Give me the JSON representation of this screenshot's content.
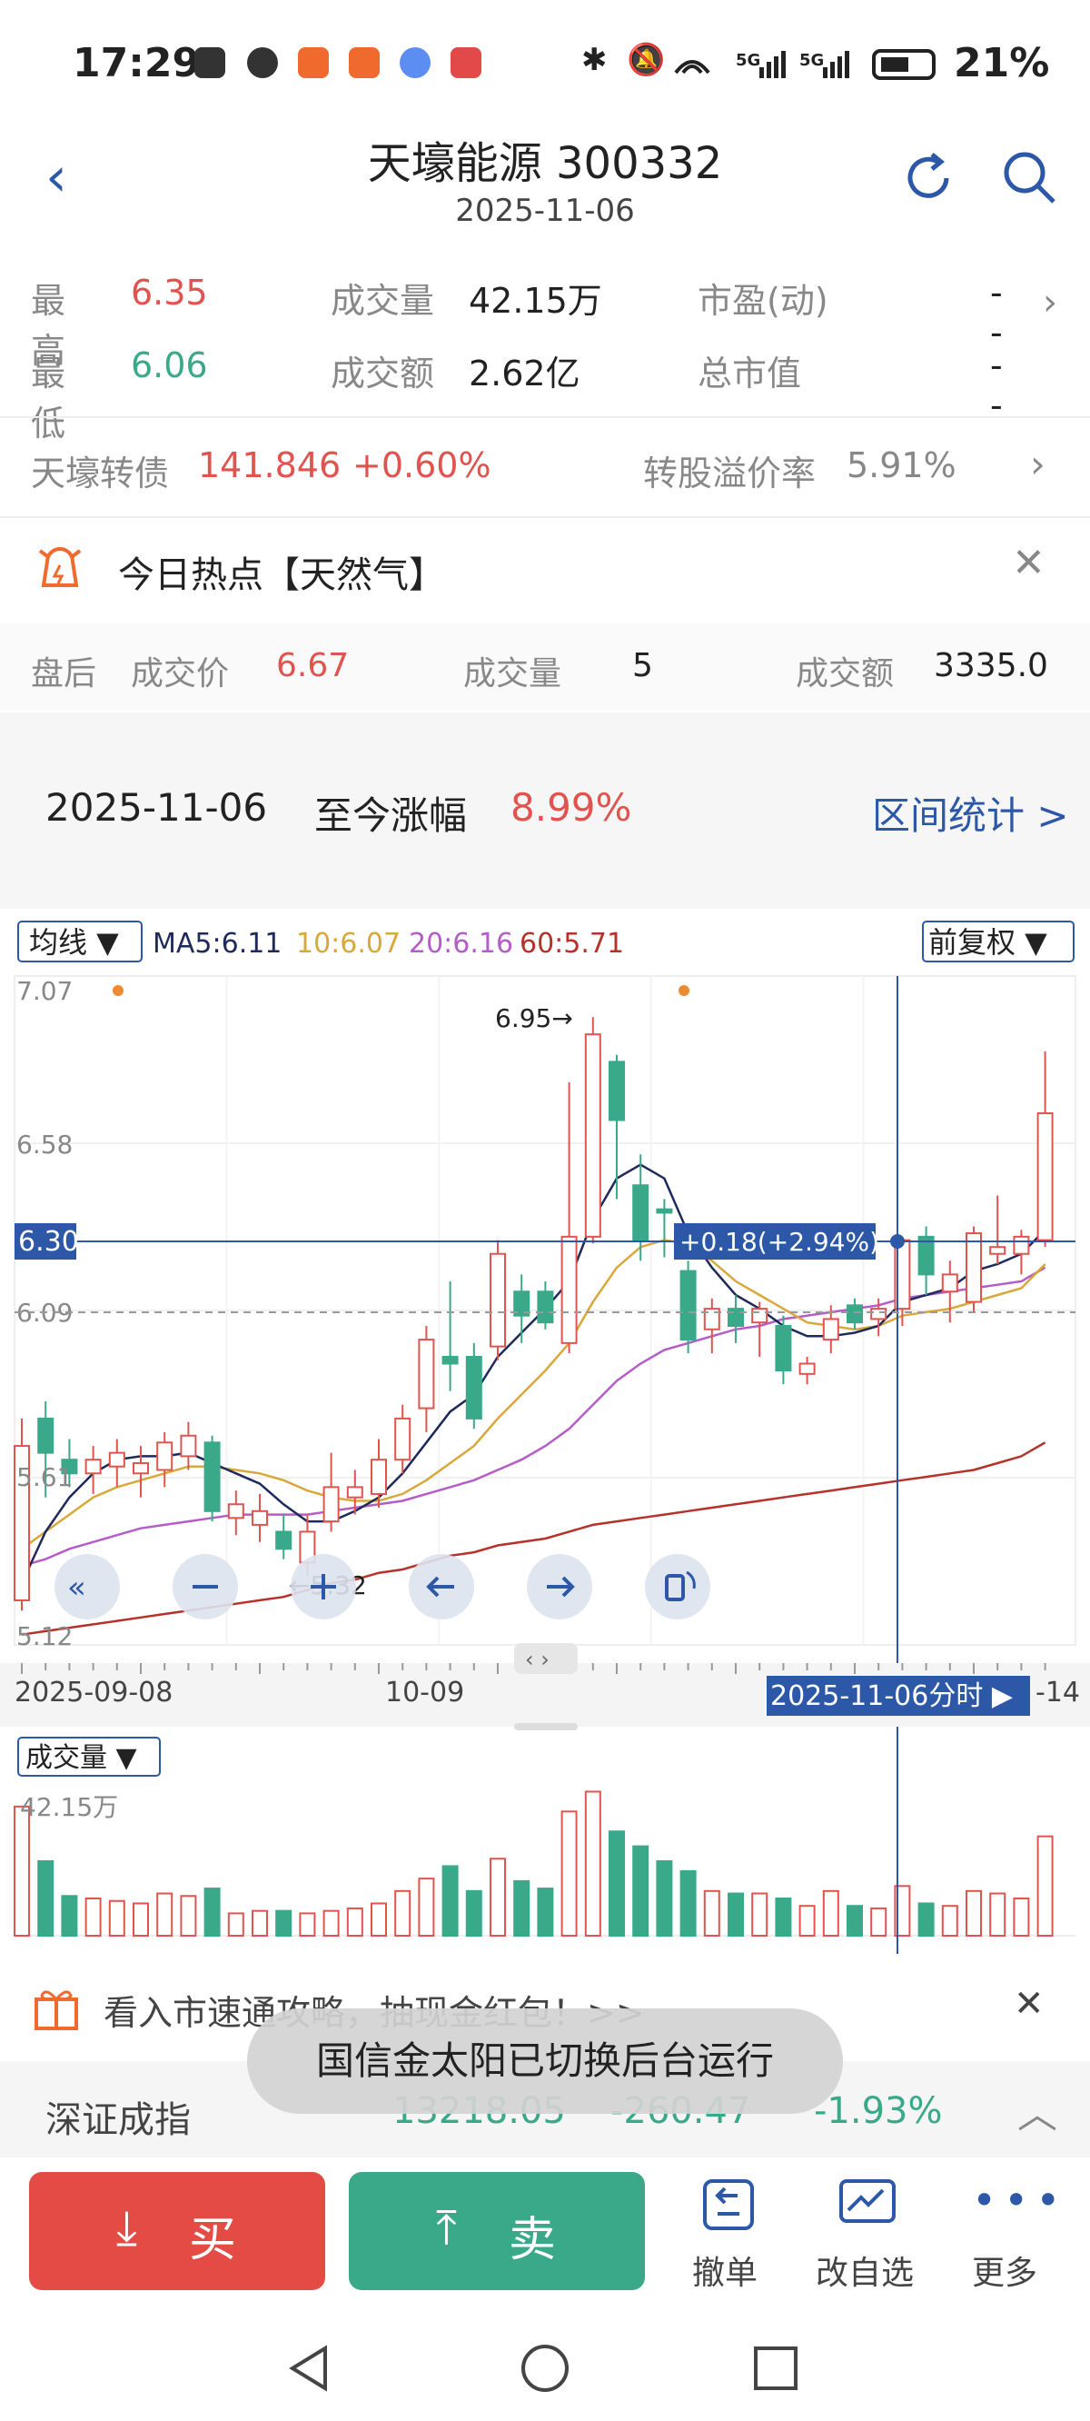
{
  "status_bar": {
    "time": "17:29",
    "battery": "21%"
  },
  "header": {
    "title": "天壕能源 300332",
    "date": "2025-11-06"
  },
  "quote": {
    "high_label": "最高",
    "high_value": "6.35",
    "low_label": "最低",
    "low_value": "6.06",
    "volume_label": "成交量",
    "volume_value": "42.15万",
    "amount_label": "成交额",
    "amount_value": "2.62亿",
    "pe_label": "市盈(动)",
    "pe_value": "--",
    "mcap_label": "总市值",
    "mcap_value": "--"
  },
  "bond": {
    "name": "天壕转债",
    "price": "141.846",
    "change": "+0.60%",
    "premium_label": "转股溢价率",
    "premium_value": "5.91%"
  },
  "hot": {
    "text": "今日热点【天然气】"
  },
  "after_hours": {
    "label": "盘后",
    "price_label": "成交价",
    "price": "6.67",
    "vol_label": "成交量",
    "vol": "5",
    "amt_label": "成交额",
    "amt": "3335.0"
  },
  "range": {
    "date": "2025-11-06",
    "label": "至今涨幅",
    "value": "8.99%",
    "stats_link": "区间统计 >"
  },
  "indicator": {
    "selector": "均线 ▼",
    "ma5": "MA5:6.11",
    "ma10": "10:6.07",
    "ma20": "20:6.16",
    "ma60": "60:5.71",
    "adjust": "前复权 ▼"
  },
  "chart_labels": {
    "high_marker": "6.95→",
    "low_marker": "←5.32",
    "crosshair_price": "6.30",
    "crosshair_change": "+0.18(+2.94%)",
    "crosshair_date": "2025-11-06分时 ▶",
    "date_left": "2025-09-08",
    "date_mid": "10-09",
    "date_right": "-14"
  },
  "volume_panel": {
    "selector": "成交量 ▼",
    "max_label": "42.15万"
  },
  "promo": {
    "text": "看入市速通攻略，抽现金红包！>>"
  },
  "index_bar": {
    "name": "深证成指",
    "value": "13218.05",
    "change": "-260.47",
    "pct": "-1.93%"
  },
  "toast": {
    "text": "国信金太阳已切换后台运行"
  },
  "bottom": {
    "buy": "买",
    "sell": "卖",
    "cancel": "撤单",
    "edit_watch": "改自选",
    "more": "更多"
  },
  "colors": {
    "up": "#e0534f",
    "down": "#3aa98a",
    "ma5": "#1f2a5c",
    "ma10": "#d8a83a",
    "ma20": "#b45cc8",
    "ma60": "#b5322a"
  },
  "chart_data": {
    "type": "candlestick",
    "ylim": [
      5.12,
      7.07
    ],
    "yticks": [
      "7.07",
      "6.58",
      "6.09",
      "5.61",
      "5.12"
    ],
    "candles": [
      {
        "o": 5.25,
        "c": 5.7,
        "h": 5.78,
        "l": 5.22
      },
      {
        "o": 5.78,
        "c": 5.68,
        "h": 5.83,
        "l": 5.55
      },
      {
        "o": 5.66,
        "c": 5.62,
        "h": 5.72,
        "l": 5.58
      },
      {
        "o": 5.62,
        "c": 5.66,
        "h": 5.7,
        "l": 5.56
      },
      {
        "o": 5.64,
        "c": 5.68,
        "h": 5.72,
        "l": 5.58
      },
      {
        "o": 5.62,
        "c": 5.65,
        "h": 5.7,
        "l": 5.55
      },
      {
        "o": 5.63,
        "c": 5.71,
        "h": 5.74,
        "l": 5.58
      },
      {
        "o": 5.67,
        "c": 5.73,
        "h": 5.77,
        "l": 5.63
      },
      {
        "o": 5.71,
        "c": 5.51,
        "h": 5.73,
        "l": 5.48
      },
      {
        "o": 5.49,
        "c": 5.53,
        "h": 5.57,
        "l": 5.44
      },
      {
        "o": 5.47,
        "c": 5.51,
        "h": 5.56,
        "l": 5.42
      },
      {
        "o": 5.45,
        "c": 5.4,
        "h": 5.5,
        "l": 5.37
      },
      {
        "o": 5.36,
        "c": 5.45,
        "h": 5.5,
        "l": 5.32
      },
      {
        "o": 5.48,
        "c": 5.58,
        "h": 5.68,
        "l": 5.45
      },
      {
        "o": 5.55,
        "c": 5.58,
        "h": 5.63,
        "l": 5.5
      },
      {
        "o": 5.56,
        "c": 5.66,
        "h": 5.72,
        "l": 5.52
      },
      {
        "o": 5.66,
        "c": 5.78,
        "h": 5.82,
        "l": 5.62
      },
      {
        "o": 5.81,
        "c": 6.01,
        "h": 6.05,
        "l": 5.74
      },
      {
        "o": 5.96,
        "c": 5.94,
        "h": 6.18,
        "l": 5.86
      },
      {
        "o": 5.96,
        "c": 5.78,
        "h": 6.0,
        "l": 5.75
      },
      {
        "o": 5.99,
        "c": 6.26,
        "h": 6.3,
        "l": 5.95
      },
      {
        "o": 6.15,
        "c": 6.08,
        "h": 6.2,
        "l": 6.0
      },
      {
        "o": 6.15,
        "c": 6.06,
        "h": 6.18,
        "l": 6.04
      },
      {
        "o": 6.0,
        "c": 6.31,
        "h": 6.76,
        "l": 5.97
      },
      {
        "o": 6.31,
        "c": 6.9,
        "h": 6.95,
        "l": 6.29
      },
      {
        "o": 6.82,
        "c": 6.65,
        "h": 6.84,
        "l": 6.42
      },
      {
        "o": 6.46,
        "c": 6.3,
        "h": 6.55,
        "l": 6.24
      },
      {
        "o": 6.39,
        "c": 6.38,
        "h": 6.42,
        "l": 6.25
      },
      {
        "o": 6.21,
        "c": 6.01,
        "h": 6.24,
        "l": 5.97
      },
      {
        "o": 6.04,
        "c": 6.1,
        "h": 6.13,
        "l": 5.97
      },
      {
        "o": 6.1,
        "c": 6.05,
        "h": 6.14,
        "l": 6.0
      },
      {
        "o": 6.06,
        "c": 6.1,
        "h": 6.12,
        "l": 5.96
      },
      {
        "o": 6.05,
        "c": 5.92,
        "h": 6.08,
        "l": 5.88
      },
      {
        "o": 5.91,
        "c": 5.94,
        "h": 5.96,
        "l": 5.88
      },
      {
        "o": 6.01,
        "c": 6.07,
        "h": 6.11,
        "l": 5.97
      },
      {
        "o": 6.11,
        "c": 6.06,
        "h": 6.13,
        "l": 6.04
      },
      {
        "o": 6.07,
        "c": 6.1,
        "h": 6.13,
        "l": 6.02
      },
      {
        "o": 6.1,
        "c": 6.3,
        "h": 6.31,
        "l": 6.05
      },
      {
        "o": 6.31,
        "c": 6.2,
        "h": 6.34,
        "l": 6.14
      },
      {
        "o": 6.15,
        "c": 6.2,
        "h": 6.24,
        "l": 6.06
      },
      {
        "o": 6.12,
        "c": 6.32,
        "h": 6.34,
        "l": 6.09
      },
      {
        "o": 6.26,
        "c": 6.28,
        "h": 6.43,
        "l": 6.23
      },
      {
        "o": 6.26,
        "c": 6.31,
        "h": 6.33,
        "l": 6.2
      },
      {
        "o": 6.3,
        "c": 6.67,
        "h": 6.85,
        "l": 6.28
      }
    ],
    "ma5": [
      5.3,
      5.45,
      5.55,
      5.62,
      5.66,
      5.67,
      5.67,
      5.68,
      5.65,
      5.62,
      5.59,
      5.53,
      5.48,
      5.48,
      5.51,
      5.55,
      5.62,
      5.71,
      5.8,
      5.85,
      5.96,
      6.03,
      6.1,
      6.18,
      6.36,
      6.48,
      6.52,
      6.48,
      6.32,
      6.22,
      6.14,
      6.1,
      6.05,
      6.02,
      6.02,
      6.03,
      6.05,
      6.12,
      6.14,
      6.16,
      6.21,
      6.23,
      6.26,
      6.33
    ],
    "ma10": [
      5.4,
      5.45,
      5.5,
      5.55,
      5.58,
      5.6,
      5.62,
      5.64,
      5.64,
      5.63,
      5.62,
      5.6,
      5.57,
      5.55,
      5.54,
      5.54,
      5.56,
      5.6,
      5.65,
      5.7,
      5.78,
      5.85,
      5.92,
      6.0,
      6.12,
      6.22,
      6.28,
      6.3,
      6.29,
      6.24,
      6.18,
      6.14,
      6.1,
      6.06,
      6.05,
      6.04,
      6.05,
      6.08,
      6.09,
      6.1,
      6.12,
      6.14,
      6.16,
      6.23
    ],
    "ma20": [
      5.35,
      5.37,
      5.4,
      5.42,
      5.44,
      5.46,
      5.47,
      5.48,
      5.49,
      5.5,
      5.5,
      5.5,
      5.5,
      5.51,
      5.52,
      5.53,
      5.54,
      5.56,
      5.58,
      5.6,
      5.63,
      5.66,
      5.7,
      5.75,
      5.82,
      5.89,
      5.94,
      5.98,
      6.0,
      6.02,
      6.04,
      6.05,
      6.07,
      6.08,
      6.09,
      6.1,
      6.11,
      6.13,
      6.14,
      6.15,
      6.16,
      6.17,
      6.18,
      6.22
    ],
    "ma60": [
      5.15,
      5.16,
      5.17,
      5.18,
      5.19,
      5.2,
      5.21,
      5.22,
      5.23,
      5.24,
      5.25,
      5.26,
      5.28,
      5.3,
      5.31,
      5.33,
      5.34,
      5.36,
      5.38,
      5.39,
      5.41,
      5.42,
      5.43,
      5.45,
      5.47,
      5.48,
      5.49,
      5.5,
      5.51,
      5.52,
      5.53,
      5.54,
      5.55,
      5.56,
      5.57,
      5.58,
      5.59,
      5.6,
      5.61,
      5.62,
      5.63,
      5.65,
      5.67,
      5.71
    ],
    "volume": [
      0.52,
      0.3,
      0.16,
      0.15,
      0.14,
      0.13,
      0.17,
      0.16,
      0.19,
      0.09,
      0.1,
      0.1,
      0.09,
      0.1,
      0.11,
      0.13,
      0.18,
      0.23,
      0.28,
      0.18,
      0.31,
      0.22,
      0.19,
      0.5,
      0.58,
      0.42,
      0.36,
      0.3,
      0.26,
      0.18,
      0.17,
      0.17,
      0.15,
      0.12,
      0.18,
      0.12,
      0.11,
      0.2,
      0.13,
      0.12,
      0.18,
      0.17,
      0.15,
      0.4
    ]
  }
}
